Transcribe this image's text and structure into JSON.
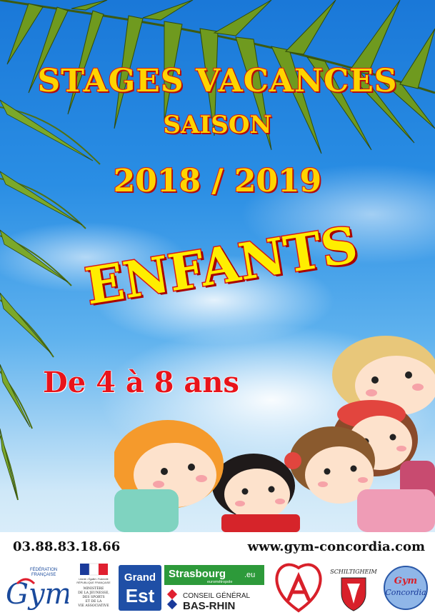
{
  "poster": {
    "title_line1": "STAGES VACANCES",
    "title_line2": "SAISON",
    "title_years": "2018 / 2019",
    "audience": "ENFANTS",
    "age_range": "De 4 à 8 ans",
    "colors": {
      "title_fill": "#ffd400",
      "title_outline": "#d81818",
      "ages_text": "#e8131a",
      "sky": "#2a8ee4"
    }
  },
  "contact": {
    "phone": "03.88.83.18.66",
    "website": "www.gym-concordia.com"
  },
  "logos": {
    "ffgym": {
      "line1": "FÉDÉRATION",
      "line2": "FRANÇAISE",
      "mark": "Gym"
    },
    "ministere": {
      "line1": "Liberté • Égalité • Fraternité",
      "line2": "RÉPUBLIQUE FRANÇAISE",
      "line3": "MINISTÈRE",
      "line4": "DE LA JEUNESSE,",
      "line5": "DES SPORTS",
      "line6": "ET DE LA",
      "line7": "VIE ASSOCIATIVE"
    },
    "grandest": {
      "line1": "Grand",
      "line2": "Est"
    },
    "strasbourg": {
      "name": "Strasbourg",
      "suffix": ".eu",
      "sub": "eurométropole"
    },
    "basrhin": {
      "line1": "CONSEIL GÉNÉRAL",
      "line2": "BAS-RHIN"
    },
    "schiltigheim": {
      "name": "SCHILTIGHEIM"
    },
    "concordia": {
      "line1": "Gym",
      "line2": "Concordia"
    }
  }
}
